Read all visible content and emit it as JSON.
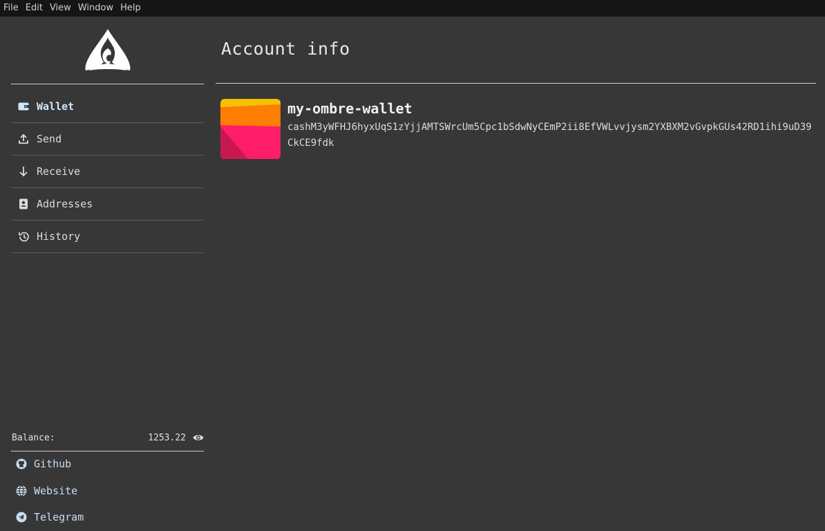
{
  "menubar": {
    "items": [
      "File",
      "Edit",
      "View",
      "Window",
      "Help"
    ]
  },
  "sidebar": {
    "logo_icon": "ombre-logo-icon",
    "nav": [
      {
        "label": "Wallet",
        "icon": "wallet-icon",
        "active": true
      },
      {
        "label": "Send",
        "icon": "upload-icon",
        "active": false
      },
      {
        "label": "Receive",
        "icon": "arrow-down-icon",
        "active": false
      },
      {
        "label": "Addresses",
        "icon": "address-book-icon",
        "active": false
      },
      {
        "label": "History",
        "icon": "history-icon",
        "active": false
      }
    ],
    "balance": {
      "label": "Balance:",
      "value": "1253.22",
      "icon": "eye-icon"
    },
    "links": [
      {
        "label": "Github",
        "icon": "github-icon"
      },
      {
        "label": "Website",
        "icon": "globe-icon"
      },
      {
        "label": "Telegram",
        "icon": "telegram-icon"
      }
    ]
  },
  "main": {
    "title": "Account info",
    "account": {
      "name": "my-ombre-wallet",
      "address": "cashM3yWFHJ6hyxUqS1zYjjAMTSWrcUm5Cpc1bSdwNyCEmP2ii8EfVWLvvjysm2YXBXM2vGvpkGUs42RD1ihi9uD39CkCE9fdk"
    }
  },
  "colors": {
    "background": "#373737",
    "menubar": "#151515",
    "active_nav": "#cfe6ff",
    "link": "#c9def3",
    "avatar_yellow": "#f5c000",
    "avatar_orange": "#ff7d00",
    "avatar_pink": "#ff1d6a"
  }
}
